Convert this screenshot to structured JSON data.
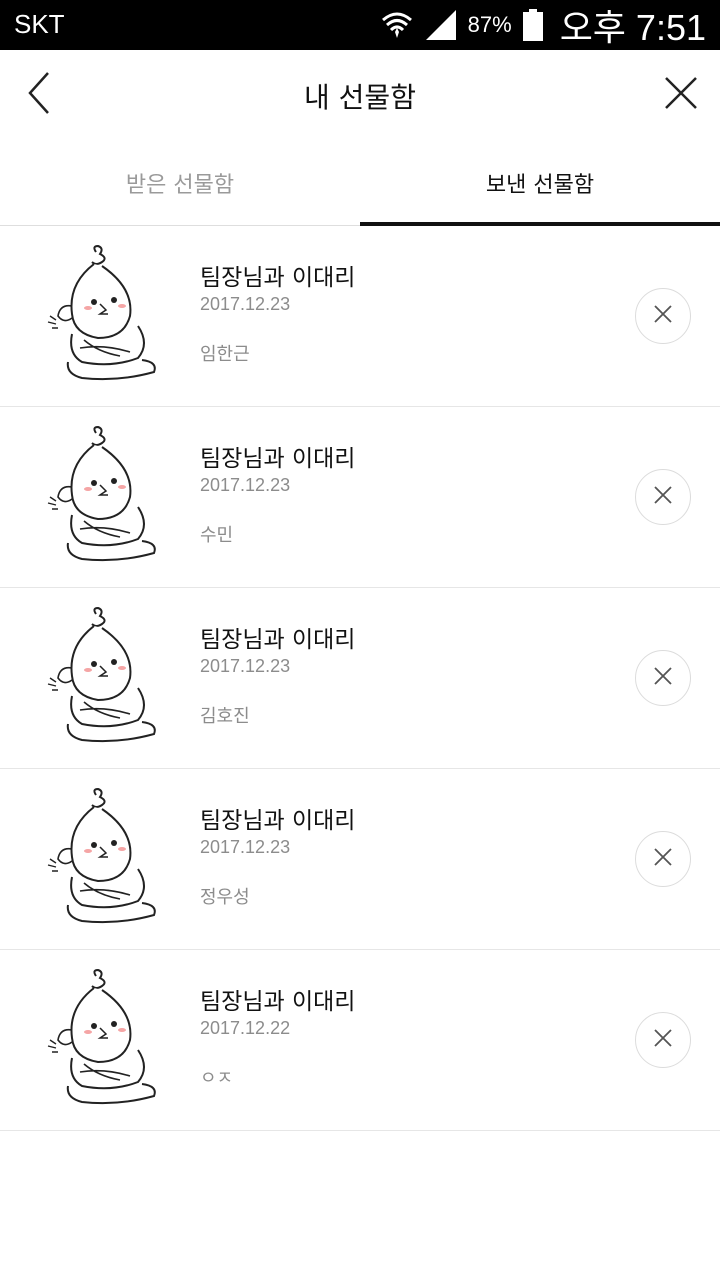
{
  "status_bar": {
    "carrier": "SKT",
    "battery_percent": "87%",
    "time": "오후 7:51"
  },
  "header": {
    "title": "내 선물함"
  },
  "tabs": [
    {
      "label": "받은 선물함",
      "active": false
    },
    {
      "label": "보낸 선물함",
      "active": true
    }
  ],
  "gifts": [
    {
      "title": "팀장님과 이대리",
      "date": "2017.12.23",
      "recipient": "임한근"
    },
    {
      "title": "팀장님과 이대리",
      "date": "2017.12.23",
      "recipient": "수민"
    },
    {
      "title": "팀장님과 이대리",
      "date": "2017.12.23",
      "recipient": "김호진"
    },
    {
      "title": "팀장님과 이대리",
      "date": "2017.12.23",
      "recipient": "정우성"
    },
    {
      "title": "팀장님과 이대리",
      "date": "2017.12.22",
      "recipient": "ㅇㅈ"
    }
  ],
  "icons": {
    "back": "chevron-left-icon",
    "close": "close-icon",
    "delete": "close-icon",
    "wifi": "wifi-icon",
    "signal": "signal-icon",
    "battery": "battery-icon",
    "thumbnail": "emoticon-character-thumbnail"
  }
}
